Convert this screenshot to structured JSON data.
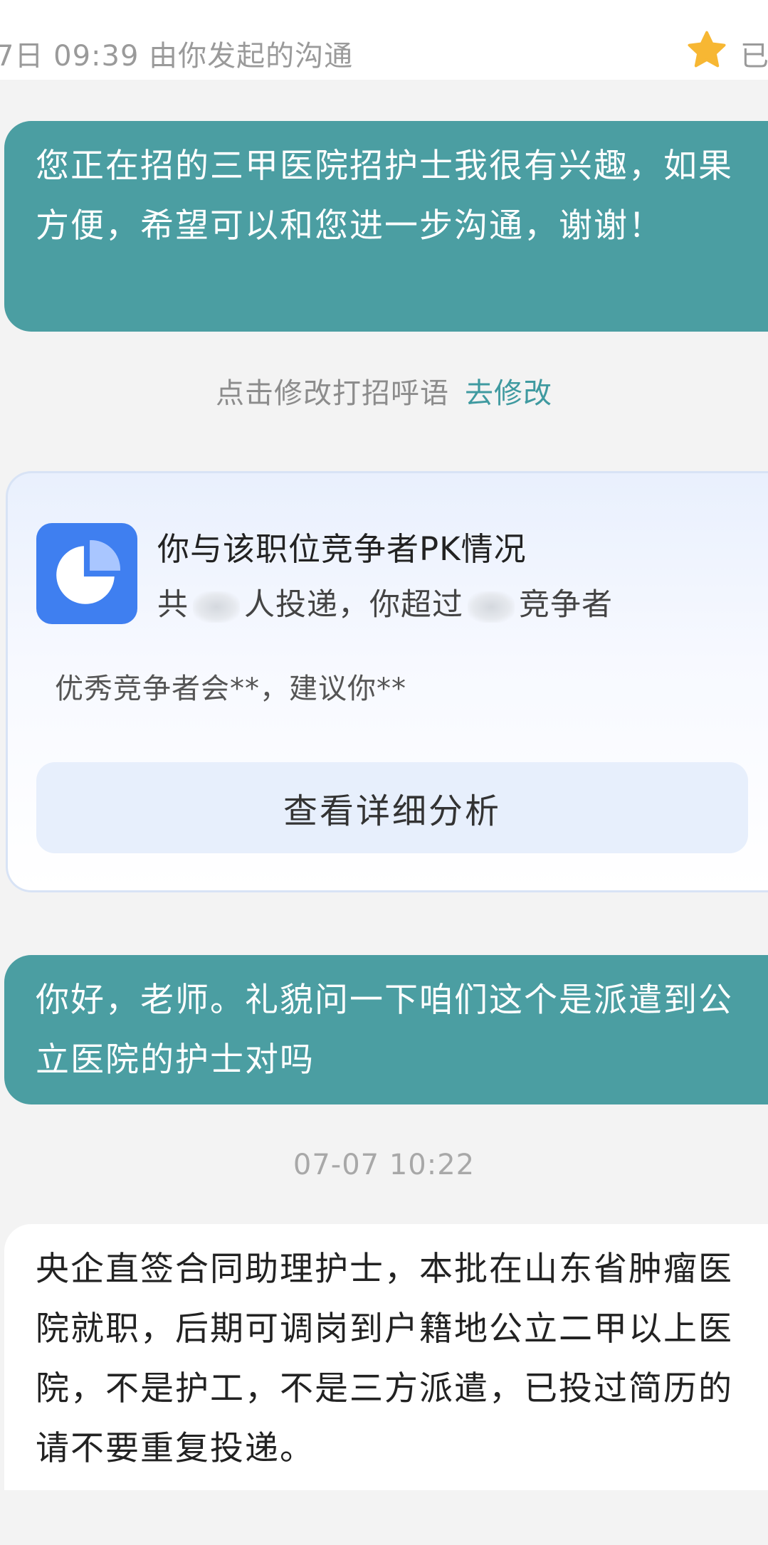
{
  "header": {
    "text": "7日 09:39 由你发起的沟通",
    "right_text": "已",
    "star_color": "#f7b733"
  },
  "messages": {
    "greeting": "您正在招的三甲医院招护士我很有兴趣，如果方便，希望可以和您进一步沟通，谢谢！",
    "question": "你好，老师。礼貌问一下咱们这个是派遣到公立医院的护士对吗",
    "reply": "央企直签合同助理护士，本批在山东省肿瘤医院就职，后期可调岗到户籍地公立二甲以上医院，不是护工，不是三方派遣，已投过简历的请不要重复投递。"
  },
  "hint": {
    "text": "点击修改打招呼语",
    "link": "去修改"
  },
  "pk_card": {
    "title": "你与该职位竞争者PK情况",
    "stats_prefix": "共",
    "stats_mid": "人投递，你超过",
    "stats_suffix": "竞争者",
    "tip": "优秀竞争者会**，建议你**",
    "button": "查看详细分析",
    "icon": "pie-chart-icon"
  },
  "timestamp": "07-07 10:22",
  "colors": {
    "sent_bubble": "#4b9ea2",
    "link": "#3f9aa0",
    "pk_icon_bg": "#3f7ff0"
  }
}
